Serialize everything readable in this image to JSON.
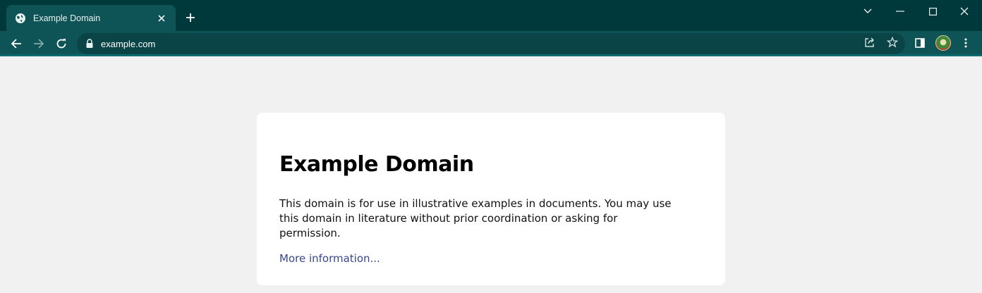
{
  "browser": {
    "tab": {
      "title": "Example Domain",
      "favicon": "globe-icon"
    },
    "address": {
      "url": "example.com"
    },
    "colors": {
      "frame": "#00393b",
      "toolbar": "#0e5356",
      "omnibox": "#0a4447"
    }
  },
  "page": {
    "heading": "Example Domain",
    "body": "This domain is for use in illustrative examples in documents. You may use this domain in literature without prior coordination or asking for permission.",
    "link_text": "More information..."
  }
}
